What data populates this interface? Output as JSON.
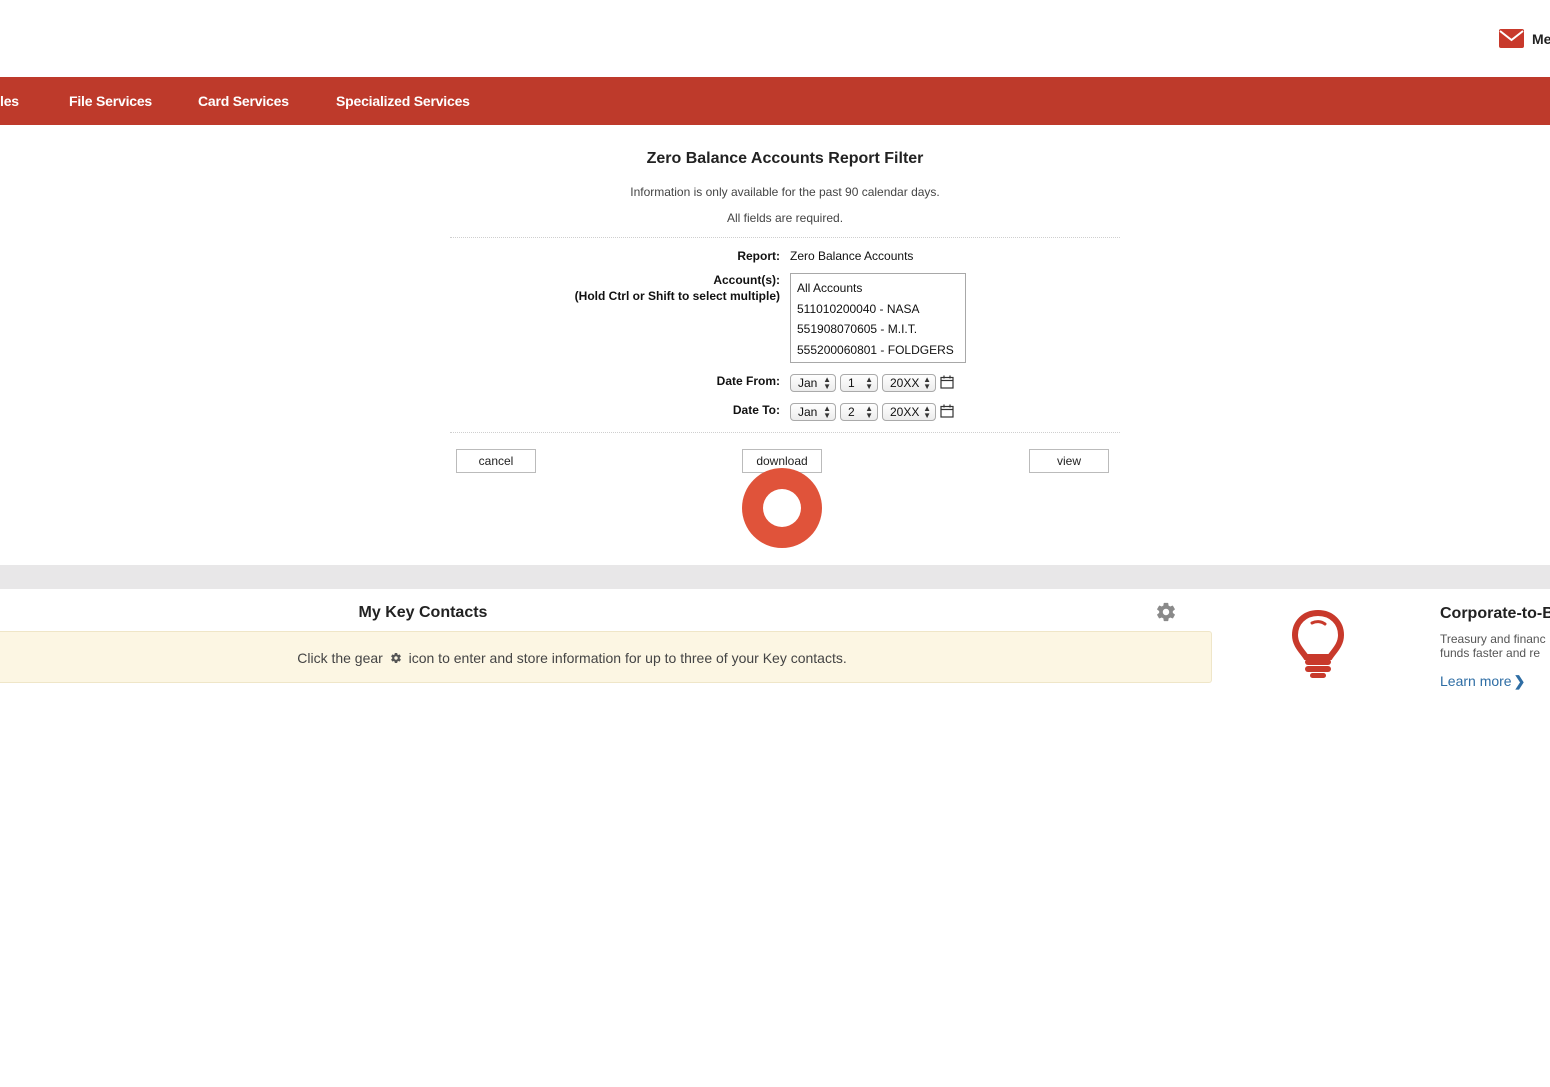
{
  "header": {
    "mail_label": "Me"
  },
  "nav": {
    "items": [
      {
        "label": "les"
      },
      {
        "label": "File Services"
      },
      {
        "label": "Card Services"
      },
      {
        "label": "Specialized Services"
      }
    ],
    "bg_color": "#be3a2b"
  },
  "filter": {
    "title": "Zero Balance Accounts Report Filter",
    "note1": "Information is only available for the past 90 calendar days.",
    "note2": "All fields are required.",
    "report_label": "Report:",
    "report_value": "Zero Balance Accounts",
    "accounts_label": "Account(s):",
    "accounts_hint": "(Hold Ctrl or Shift to select multiple)",
    "accounts": [
      "All Accounts",
      "511010200040 - NASA",
      "551908070605 - M.I.T.",
      "555200060801 - FOLDGERS"
    ],
    "date_from_label": "Date From:",
    "date_from": {
      "month": "Jan",
      "day": "1",
      "year": "20XX"
    },
    "date_to_label": "Date To:",
    "date_to": {
      "month": "Jan",
      "day": "2",
      "year": "20XX"
    },
    "buttons": {
      "cancel": "cancel",
      "download": "download",
      "view": "view"
    }
  },
  "key_contacts": {
    "title": "My Key Contacts",
    "msg_before": "Click the gear",
    "msg_after": "icon to enter and store information for up to three of your Key contacts."
  },
  "promo": {
    "title": "Corporate-to-B",
    "text_line1": "Treasury and financ",
    "text_line2": "funds faster and re",
    "link": "Learn more"
  },
  "colors": {
    "accent": "#be3a2b",
    "click_marker": "#e0533a",
    "notice_bg": "#fcf6e3",
    "link": "#2e6da4"
  }
}
